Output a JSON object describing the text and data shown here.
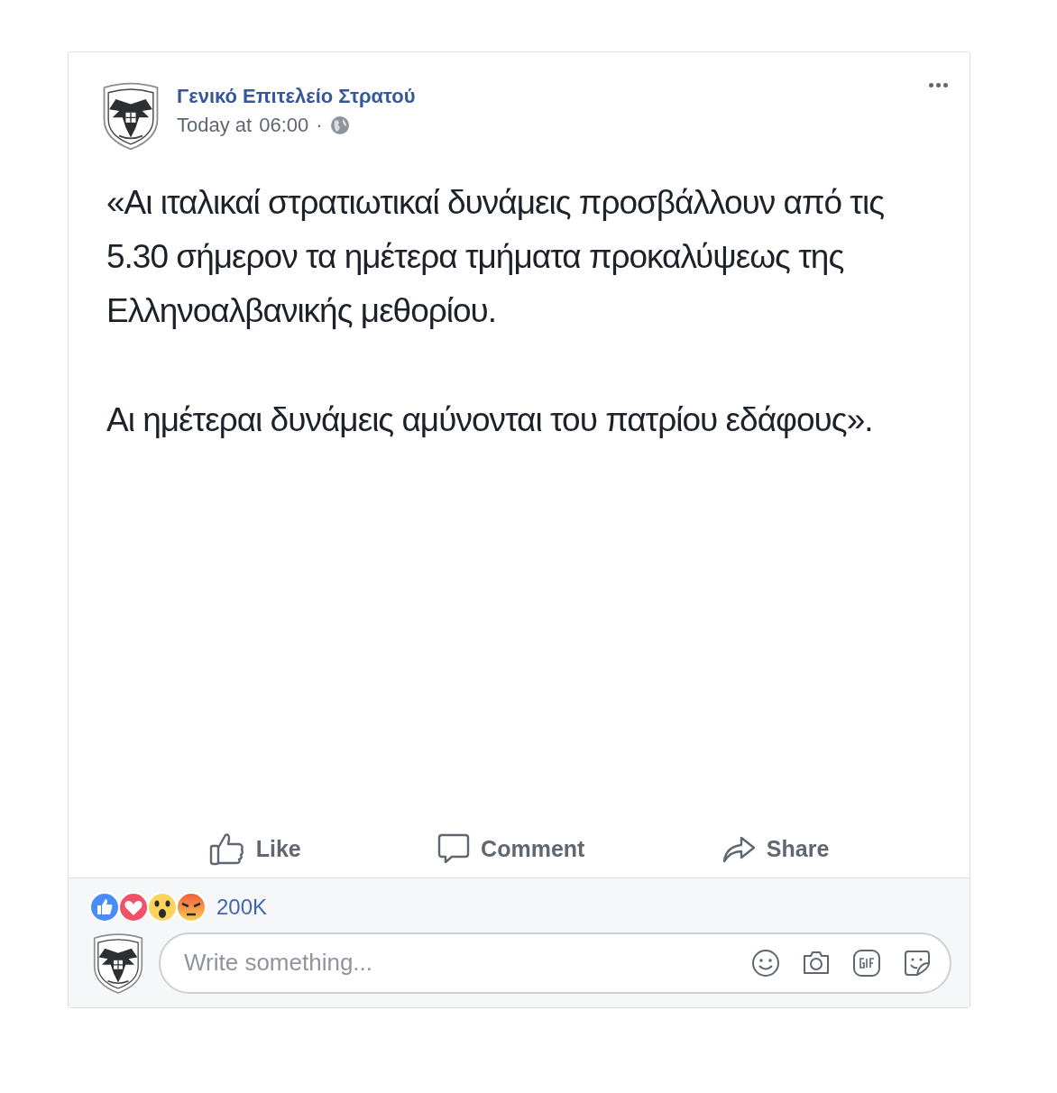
{
  "post": {
    "author": "Γενικό Επιτελείο Στρατού",
    "time_prefix": "Today at",
    "time": "06:00",
    "separator": "·",
    "paragraphs": [
      "«Αι ιταλικαί στρατιωτικαί δυνάμεις προσβάλλουν από τις 5.30 σήμερον τα ημέτερα τμήματα προκαλύψεως της Ελληνοαλβανικής μεθορίου.",
      "Αι ημέτεραι δυνάμεις αμύνονται του πατρίου εδάφους»."
    ]
  },
  "actions": [
    {
      "kind": "like",
      "label": "Like"
    },
    {
      "kind": "comment",
      "label": "Comment"
    },
    {
      "kind": "share",
      "label": "Share"
    }
  ],
  "reactions": {
    "kinds": [
      {
        "kind": "like"
      },
      {
        "kind": "love"
      },
      {
        "kind": "wow"
      },
      {
        "kind": "angry"
      }
    ],
    "count": "200K"
  },
  "comment_box": {
    "placeholder": "Write something...",
    "tools": [
      {
        "kind": "emoji"
      },
      {
        "kind": "camera"
      },
      {
        "kind": "gif"
      },
      {
        "kind": "sticker"
      }
    ]
  }
}
